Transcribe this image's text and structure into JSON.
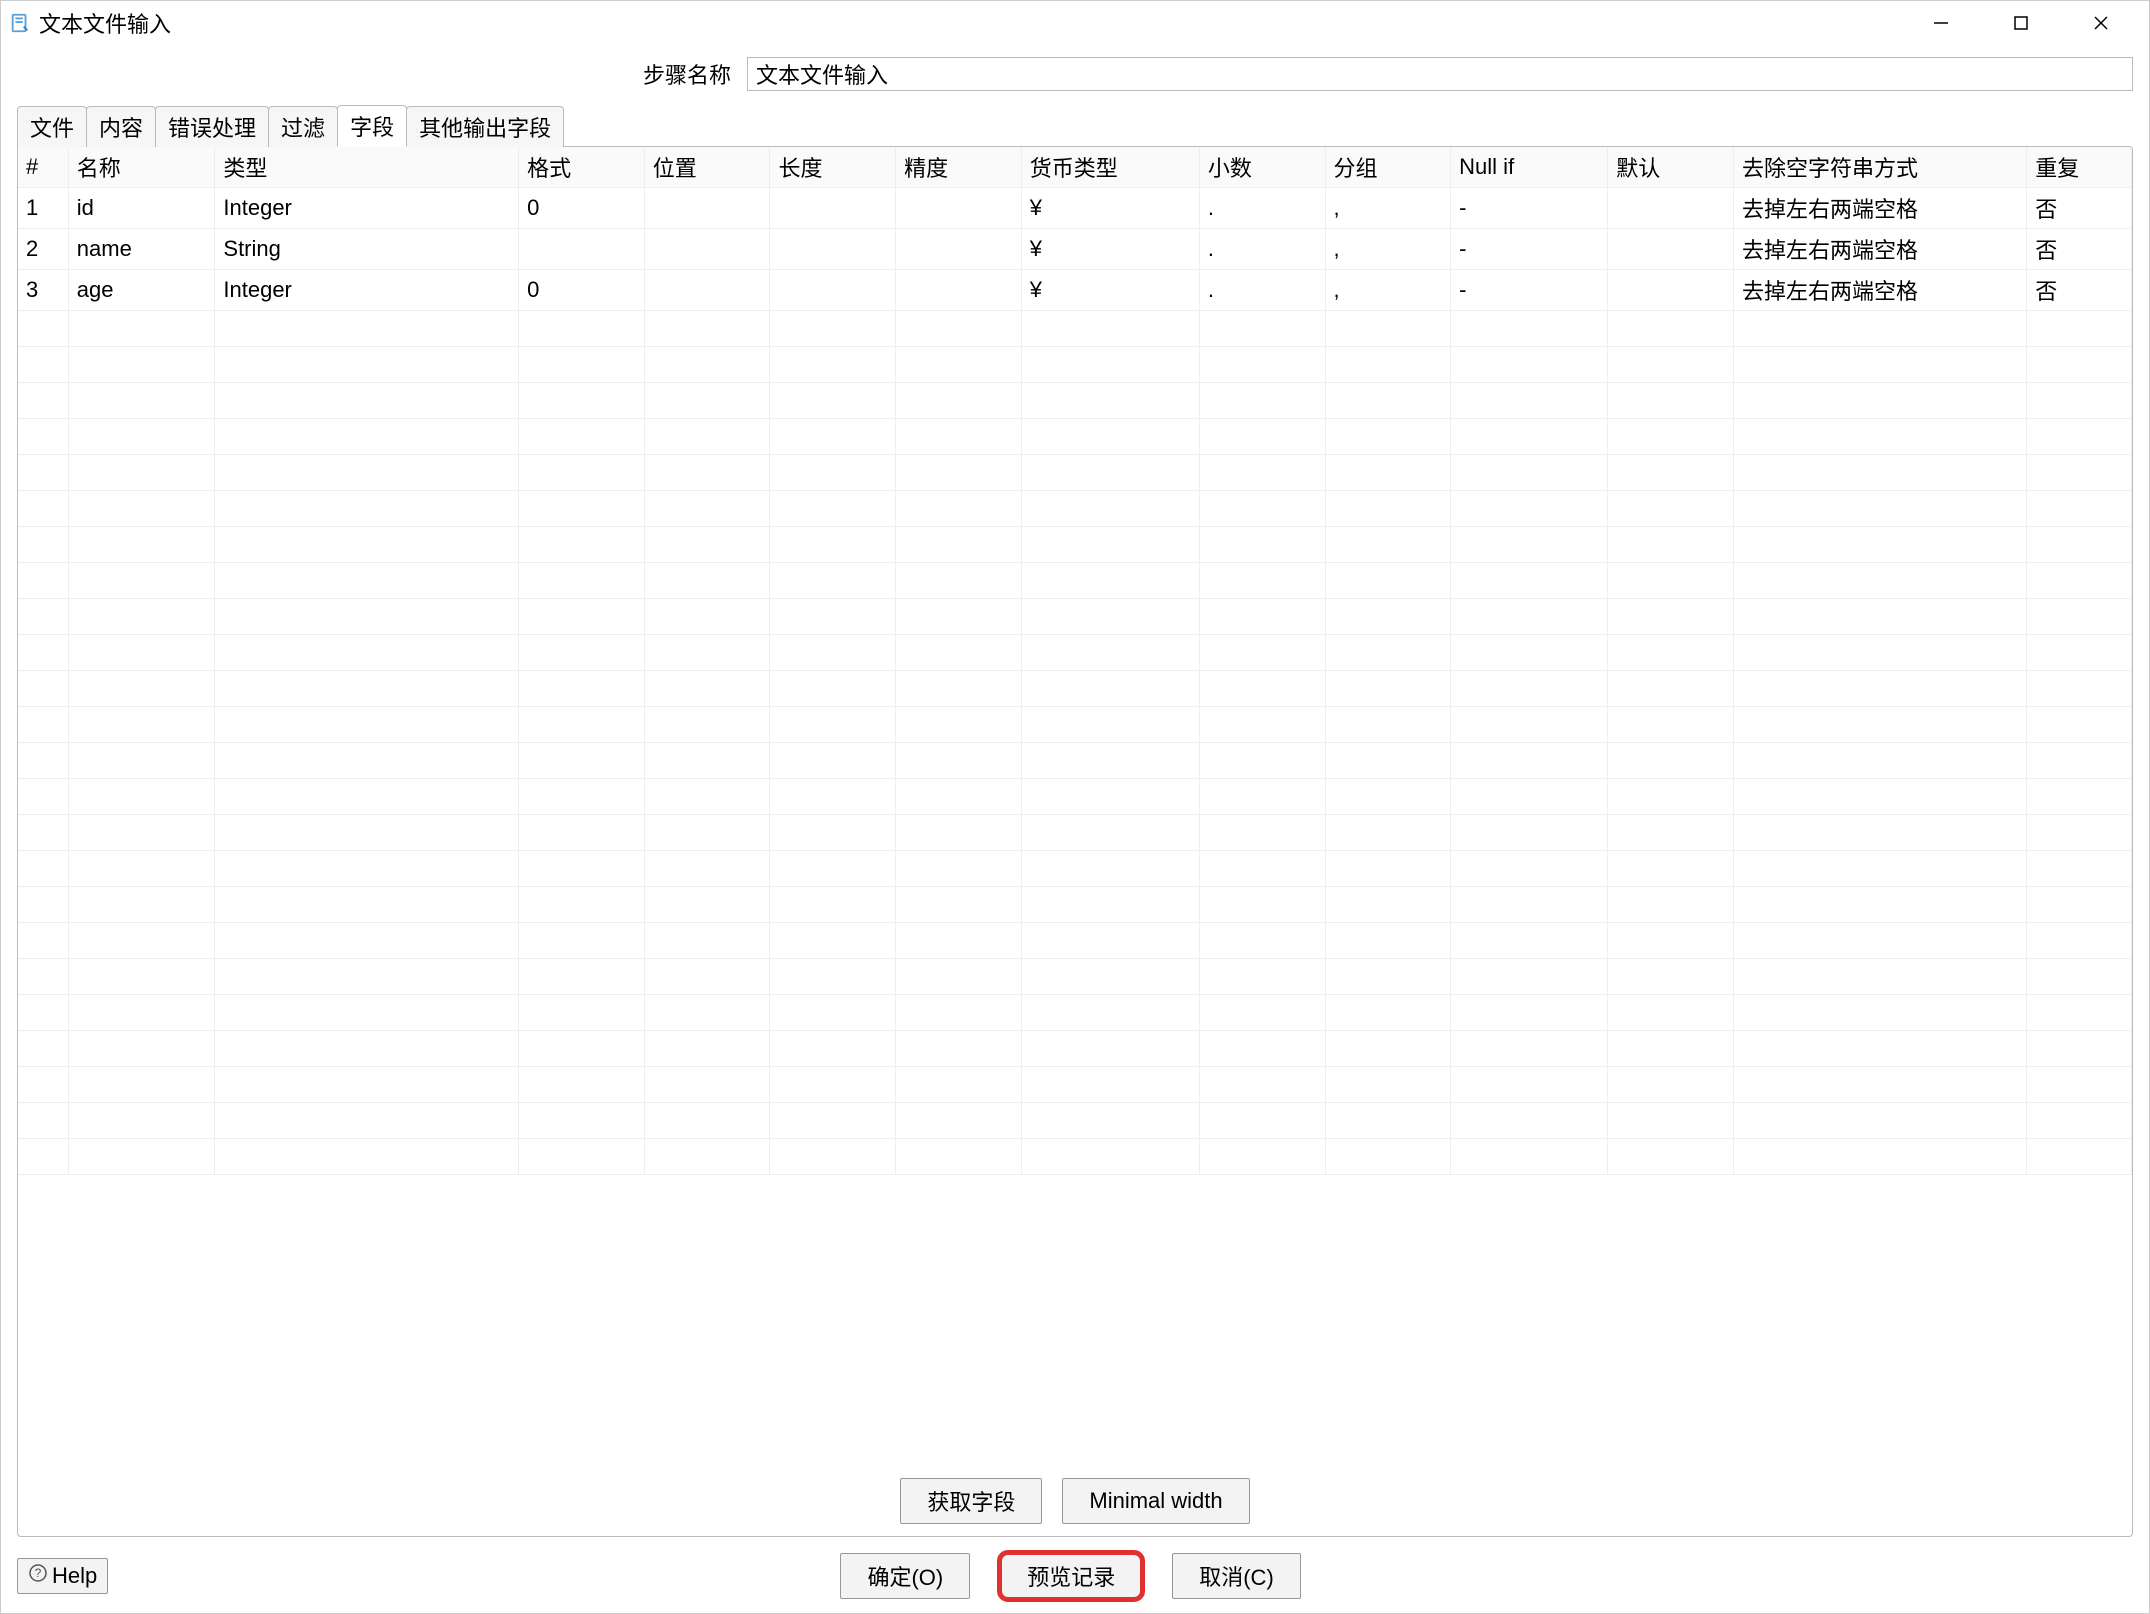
{
  "window": {
    "title": "文本文件输入"
  },
  "step_name": {
    "label": "步骤名称",
    "value": "文本文件输入"
  },
  "tabs": [
    {
      "id": "file",
      "label": "文件",
      "active": false
    },
    {
      "id": "content",
      "label": "内容",
      "active": false
    },
    {
      "id": "error",
      "label": "错误处理",
      "active": false
    },
    {
      "id": "filter",
      "label": "过滤",
      "active": false
    },
    {
      "id": "fields",
      "label": "字段",
      "active": true
    },
    {
      "id": "other",
      "label": "其他输出字段",
      "active": false
    }
  ],
  "table": {
    "headers": {
      "num": "#",
      "name": "名称",
      "type": "类型",
      "format": "格式",
      "position": "位置",
      "length": "长度",
      "precision": "精度",
      "currency": "货币类型",
      "decimal": "小数",
      "group": "分组",
      "nullif": "Null if",
      "default": "默认",
      "trim": "去除空字符串方式",
      "repeat": "重复"
    },
    "rows": [
      {
        "num": "1",
        "name": "id",
        "type": "Integer",
        "format": "0",
        "position": "",
        "length": "",
        "precision": "",
        "currency": "¥",
        "decimal": ".",
        "group": ",",
        "nullif": "-",
        "default": "",
        "trim": "去掉左右两端空格",
        "repeat": "否"
      },
      {
        "num": "2",
        "name": "name",
        "type": "String",
        "format": "",
        "position": "",
        "length": "",
        "precision": "",
        "currency": "¥",
        "decimal": ".",
        "group": ",",
        "nullif": "-",
        "default": "",
        "trim": "去掉左右两端空格",
        "repeat": "否"
      },
      {
        "num": "3",
        "name": "age",
        "type": "Integer",
        "format": "0",
        "position": "",
        "length": "",
        "precision": "",
        "currency": "¥",
        "decimal": ".",
        "group": ",",
        "nullif": "-",
        "default": "",
        "trim": "去掉左右两端空格",
        "repeat": "否"
      }
    ]
  },
  "panel_buttons": {
    "get_fields": "获取字段",
    "min_width": "Minimal width"
  },
  "footer": {
    "ok": "确定(O)",
    "preview": "预览记录",
    "cancel": "取消(C)",
    "help": "Help"
  }
}
